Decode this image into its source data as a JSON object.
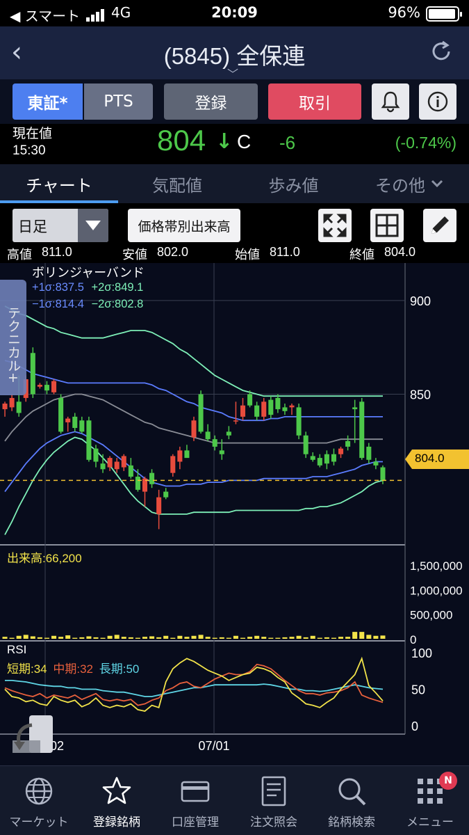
{
  "status_bar": {
    "carrier": "◀ スマート",
    "network": "4G",
    "time": "20:09",
    "battery": "96%"
  },
  "header": {
    "title": "(5845) 全保連"
  },
  "actions": {
    "exchange_tosho": "東証*",
    "exchange_pts": "PTS",
    "register": "登録",
    "trade": "取引"
  },
  "price": {
    "label_line1": "現在値",
    "label_line2": "15:30",
    "value": "804",
    "direction_glyph": "↓",
    "flag": "C",
    "change": "-6",
    "change_pct": "(-0.74%)"
  },
  "tabs": [
    "チャート",
    "気配値",
    "歩み値",
    "その他"
  ],
  "toolbar": {
    "period": "日足",
    "volume_profile": "価格帯別出来高"
  },
  "ohlc": {
    "high_label": "高値",
    "high": "811.0",
    "low_label": "安値",
    "low": "802.0",
    "open_label": "始値",
    "open": "811.0",
    "close_label": "終値",
    "close": "804.0"
  },
  "side_tab": {
    "label": "テクニカル+"
  },
  "colors": {
    "up": "#e84c3d",
    "down": "#4dc84a",
    "accent": "#4d7ff0",
    "trade": "#e04b61",
    "current_price": "#f2c230"
  },
  "chart_data": [
    {
      "type": "candlestick",
      "title": "ボリンジャーバンド",
      "indicator_labels": {
        "p1": "+1σ:837.5",
        "p2": "+2σ:849.1",
        "m1": "−1σ:814.4",
        "m2": "−2σ:802.8"
      },
      "y_ticks": [
        "900",
        "850"
      ],
      "ylim": [
        770,
        920
      ],
      "current_price_label": "804.0",
      "x_tick_labels": [
        "02",
        "07/01"
      ],
      "candles": [
        {
          "o": 842,
          "h": 846,
          "l": 838,
          "c": 845
        },
        {
          "o": 843,
          "h": 850,
          "l": 841,
          "c": 848
        },
        {
          "o": 846,
          "h": 860,
          "l": 838,
          "c": 840
        },
        {
          "o": 848,
          "h": 860,
          "l": 846,
          "c": 858
        },
        {
          "o": 872,
          "h": 875,
          "l": 848,
          "c": 850
        },
        {
          "o": 854,
          "h": 856,
          "l": 853,
          "c": 855
        },
        {
          "o": 855,
          "h": 857,
          "l": 850,
          "c": 852
        },
        {
          "o": 851,
          "h": 858,
          "l": 850,
          "c": 857
        },
        {
          "o": 848,
          "h": 850,
          "l": 829,
          "c": 830
        },
        {
          "o": 835,
          "h": 838,
          "l": 830,
          "c": 837
        },
        {
          "o": 838,
          "h": 840,
          "l": 830,
          "c": 832
        },
        {
          "o": 836,
          "h": 838,
          "l": 829,
          "c": 830
        },
        {
          "o": 836,
          "h": 838,
          "l": 814,
          "c": 815
        },
        {
          "o": 821,
          "h": 823,
          "l": 811,
          "c": 814
        },
        {
          "o": 813,
          "h": 818,
          "l": 808,
          "c": 810
        },
        {
          "o": 811,
          "h": 817,
          "l": 809,
          "c": 816
        },
        {
          "o": 810,
          "h": 816,
          "l": 808,
          "c": 814
        },
        {
          "o": 811,
          "h": 818,
          "l": 809,
          "c": 817
        },
        {
          "o": 812,
          "h": 816,
          "l": 805,
          "c": 806
        },
        {
          "o": 806,
          "h": 810,
          "l": 798,
          "c": 799
        },
        {
          "o": 798,
          "h": 806,
          "l": 790,
          "c": 805
        },
        {
          "o": 808,
          "h": 810,
          "l": 800,
          "c": 802
        },
        {
          "o": 786,
          "h": 799,
          "l": 778,
          "c": 795
        },
        {
          "o": 798,
          "h": 800,
          "l": 794,
          "c": 795
        },
        {
          "o": 808,
          "h": 818,
          "l": 806,
          "c": 817
        },
        {
          "o": 814,
          "h": 822,
          "l": 810,
          "c": 820
        },
        {
          "o": 820,
          "h": 823,
          "l": 817,
          "c": 816
        },
        {
          "o": 827,
          "h": 838,
          "l": 825,
          "c": 836
        },
        {
          "o": 850,
          "h": 852,
          "l": 829,
          "c": 830
        },
        {
          "o": 830,
          "h": 834,
          "l": 825,
          "c": 826
        },
        {
          "o": 826,
          "h": 828,
          "l": 820,
          "c": 822
        },
        {
          "o": 820,
          "h": 826,
          "l": 815,
          "c": 818
        },
        {
          "o": 830,
          "h": 833,
          "l": 826,
          "c": 828
        },
        {
          "o": 836,
          "h": 846,
          "l": 834,
          "c": 836
        },
        {
          "o": 838,
          "h": 848,
          "l": 836,
          "c": 844
        },
        {
          "o": 850,
          "h": 852,
          "l": 843,
          "c": 844
        },
        {
          "o": 844,
          "h": 846,
          "l": 836,
          "c": 838
        },
        {
          "o": 838,
          "h": 848,
          "l": 836,
          "c": 846
        },
        {
          "o": 847,
          "h": 849,
          "l": 837,
          "c": 839
        },
        {
          "o": 848,
          "h": 850,
          "l": 840,
          "c": 842
        },
        {
          "o": 843,
          "h": 845,
          "l": 839,
          "c": 841
        },
        {
          "o": 843,
          "h": 845,
          "l": 839,
          "c": 844
        },
        {
          "o": 843,
          "h": 845,
          "l": 826,
          "c": 828
        },
        {
          "o": 828,
          "h": 830,
          "l": 816,
          "c": 818
        },
        {
          "o": 817,
          "h": 819,
          "l": 814,
          "c": 815
        },
        {
          "o": 816,
          "h": 818,
          "l": 811,
          "c": 812
        },
        {
          "o": 818,
          "h": 820,
          "l": 810,
          "c": 813
        },
        {
          "o": 818,
          "h": 821,
          "l": 812,
          "c": 814
        },
        {
          "o": 818,
          "h": 822,
          "l": 816,
          "c": 821
        },
        {
          "o": 825,
          "h": 828,
          "l": 820,
          "c": 822
        },
        {
          "o": 843,
          "h": 847,
          "l": 824,
          "c": 842
        },
        {
          "o": 846,
          "h": 848,
          "l": 815,
          "c": 816
        },
        {
          "o": 822,
          "h": 824,
          "l": 813,
          "c": 815
        },
        {
          "o": 814,
          "h": 816,
          "l": 810,
          "c": 812
        },
        {
          "o": 811,
          "h": 812,
          "l": 802,
          "c": 804
        }
      ],
      "bollinger": {
        "plus2": [
          897,
          895,
          893,
          892,
          890,
          888,
          886,
          885,
          883,
          882,
          881,
          880,
          880,
          880,
          880,
          881,
          882,
          883,
          884,
          884,
          884,
          883,
          881,
          879,
          877,
          874,
          872,
          869,
          866,
          863,
          860,
          858,
          856,
          854,
          852,
          851,
          850,
          849,
          849,
          849,
          849,
          849,
          849,
          849,
          849,
          849,
          849,
          849,
          849,
          849,
          849,
          849,
          849,
          849,
          849
        ],
        "plus1": [
          868,
          867,
          865,
          863,
          861,
          860,
          859,
          858,
          857,
          856,
          856,
          856,
          856,
          856,
          856,
          856,
          856,
          856,
          856,
          856,
          856,
          855,
          853,
          852,
          850,
          848,
          846,
          845,
          843,
          842,
          841,
          840,
          838,
          837,
          836,
          836,
          836,
          836,
          837,
          837,
          838,
          838,
          838,
          838,
          838,
          838,
          838,
          838,
          838,
          838,
          838,
          838,
          838,
          838,
          838
        ],
        "middle": [
          825,
          830,
          834,
          838,
          841,
          843,
          845,
          847,
          848,
          849,
          850,
          850,
          849,
          848,
          847,
          845,
          843,
          841,
          839,
          837,
          835,
          834,
          832,
          831,
          830,
          829,
          828,
          827,
          826,
          825,
          824,
          824,
          824,
          824,
          824,
          824,
          824,
          824,
          824,
          824,
          824,
          824,
          824,
          824,
          824,
          824,
          824,
          825,
          826,
          826,
          826,
          826,
          826,
          826,
          826
        ],
        "minus1": [
          798,
          803,
          808,
          813,
          817,
          821,
          824,
          826,
          828,
          829,
          830,
          829,
          827,
          825,
          823,
          820,
          817,
          814,
          811,
          808,
          805,
          803,
          802,
          801,
          801,
          801,
          802,
          802,
          802,
          803,
          803,
          803,
          804,
          804,
          804,
          804,
          804,
          805,
          805,
          805,
          805,
          805,
          805,
          805,
          806,
          806,
          806,
          807,
          808,
          809,
          810,
          812,
          813,
          814,
          814
        ],
        "minus2": [
          775,
          782,
          790,
          797,
          804,
          810,
          815,
          819,
          822,
          825,
          827,
          826,
          823,
          820,
          816,
          812,
          807,
          802,
          797,
          793,
          790,
          787,
          786,
          786,
          786,
          786,
          786,
          787,
          787,
          787,
          787,
          787,
          787,
          788,
          788,
          788,
          788,
          788,
          788,
          788,
          788,
          788,
          788,
          789,
          789,
          790,
          790,
          791,
          792,
          794,
          796,
          798,
          801,
          803,
          804
        ]
      }
    },
    {
      "type": "bar",
      "title": "出来高:66,200",
      "y_ticks": [
        "1,500,000",
        "1,000,000",
        "500,000",
        "0"
      ],
      "ylim": [
        0,
        1700000
      ],
      "values": [
        40000,
        20000,
        60000,
        80000,
        50000,
        30000,
        20000,
        60000,
        40000,
        70000,
        20000,
        30000,
        50000,
        30000,
        20000,
        60000,
        80000,
        40000,
        30000,
        20000,
        40000,
        50000,
        30000,
        60000,
        20000,
        60000,
        40000,
        60000,
        80000,
        40000,
        20000,
        30000,
        20000,
        60000,
        20000,
        40000,
        60000,
        40000,
        20000,
        20000,
        30000,
        40000,
        60000,
        30000,
        60000,
        20000,
        30000,
        20000,
        40000,
        40000,
        140000,
        140000,
        80000,
        60000,
        66200
      ]
    },
    {
      "type": "line",
      "title": "RSI",
      "series": [
        {
          "name": "短期:34",
          "color": "#f2e34a",
          "values": [
            50,
            40,
            38,
            33,
            35,
            30,
            28,
            40,
            35,
            32,
            35,
            26,
            30,
            38,
            28,
            25,
            28,
            26,
            30,
            22,
            20,
            28,
            25,
            60,
            78,
            86,
            92,
            88,
            82,
            76,
            72,
            68,
            62,
            66,
            70,
            72,
            80,
            78,
            74,
            66,
            60,
            45,
            38,
            30,
            28,
            25,
            32,
            38,
            50,
            60,
            70,
            92,
            55,
            45,
            34
          ]
        },
        {
          "name": "中期:32",
          "color": "#e8603c",
          "values": [
            52,
            48,
            45,
            42,
            40,
            44,
            38,
            42,
            40,
            38,
            42,
            36,
            40,
            44,
            36,
            34,
            36,
            34,
            36,
            28,
            30,
            35,
            38,
            48,
            52,
            58,
            60,
            54,
            52,
            58,
            64,
            68,
            72,
            70,
            70,
            74,
            84,
            82,
            78,
            70,
            62,
            55,
            48,
            44,
            44,
            42,
            45,
            46,
            48,
            52,
            60,
            42,
            38,
            35,
            32
          ]
        },
        {
          "name": "長期:50",
          "color": "#5fd6e6",
          "values": [
            62,
            62,
            61,
            60,
            58,
            56,
            55,
            54,
            54,
            52,
            52,
            50,
            50,
            50,
            48,
            47,
            46,
            46,
            44,
            42,
            40,
            40,
            42,
            44,
            46,
            48,
            50,
            52,
            52,
            54,
            56,
            56,
            56,
            56,
            56,
            56,
            56,
            57,
            56,
            54,
            52,
            50,
            50,
            48,
            48,
            47,
            48,
            50,
            52,
            54,
            56,
            54,
            52,
            51,
            50
          ]
        }
      ],
      "y_ticks": [
        "100",
        "50",
        "0"
      ],
      "ylim": [
        0,
        100
      ]
    }
  ],
  "bottom_nav": [
    {
      "label": "マーケット",
      "icon": "globe-icon"
    },
    {
      "label": "登録銘柄",
      "icon": "star-icon"
    },
    {
      "label": "口座管理",
      "icon": "card-icon"
    },
    {
      "label": "注文照会",
      "icon": "document-icon"
    },
    {
      "label": "銘柄検索",
      "icon": "search-icon"
    },
    {
      "label": "メニュー",
      "icon": "grid-icon",
      "badge": "N"
    }
  ]
}
